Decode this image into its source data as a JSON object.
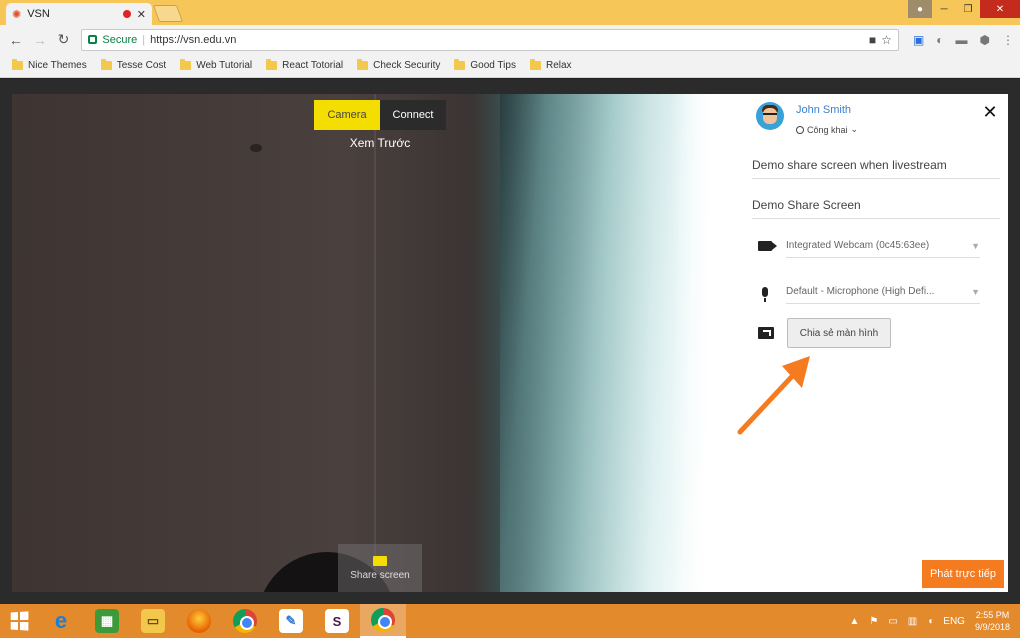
{
  "browser": {
    "tab_title": "VSN",
    "url_secure_label": "Secure",
    "url": "https://vsn.edu.vn",
    "bookmarks": [
      "Nice Themes",
      "Tesse Cost",
      "Web Tutorial",
      "React Totorial",
      "Check Security",
      "Good Tips",
      "Relax"
    ]
  },
  "preview": {
    "tabs": [
      "Camera",
      "Connect"
    ],
    "label": "Xem Trước",
    "share_overlay_label": "Share screen"
  },
  "side": {
    "user_name": "John Smith",
    "privacy_label": "Công khai",
    "title_field": "Demo share screen when livestream",
    "description_field": "Demo Share Screen",
    "camera_select": "Integrated Webcam (0c45:63ee)",
    "mic_select": "Default - Microphone (High Defi...",
    "share_screen_button": "Chia sẻ màn hình",
    "go_live_button": "Phát trực tiếp"
  },
  "taskbar": {
    "language": "ENG",
    "time": "2:55 PM",
    "date": "9/9/2018"
  },
  "colors": {
    "accent_orange": "#f47b20",
    "camera_tab_yellow": "#f4dd00",
    "user_link_blue": "#3b7fd0",
    "tab_strip": "#f6c659",
    "taskbar": "#e28a2c"
  }
}
